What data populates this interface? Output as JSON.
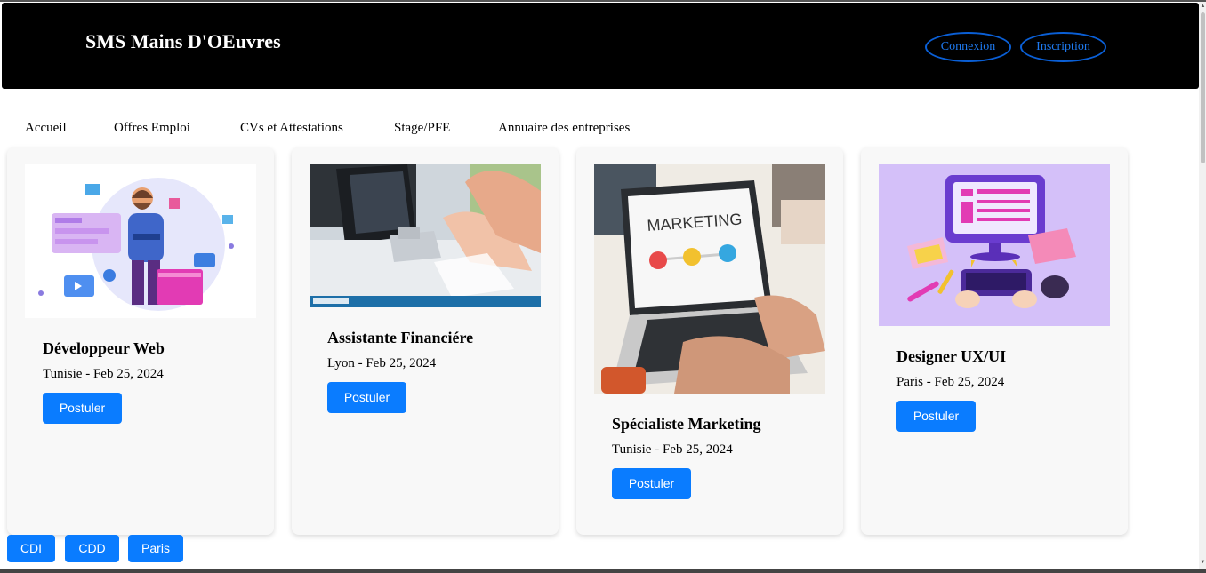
{
  "header": {
    "brand": "SMS Mains D'OEuvres",
    "login_label": "Connexion",
    "signup_label": "Inscription"
  },
  "nav": {
    "items": [
      "Accueil",
      "Offres Emploi",
      "CVs et Attestations",
      "Stage/PFE",
      "Annuaire des entreprises"
    ]
  },
  "jobs": [
    {
      "title": "Développeur Web",
      "meta": "Tunisie - Feb 25, 2024",
      "apply_label": "Postuler",
      "image": "developer-illustration"
    },
    {
      "title": "Assistante Financiére",
      "meta": "Lyon - Feb 25, 2024",
      "apply_label": "Postuler",
      "image": "finance-photo"
    },
    {
      "title": "Spécialiste Marketing",
      "meta": "Tunisie - Feb 25, 2024",
      "apply_label": "Postuler",
      "image": "marketing-photo",
      "image_text": "MARKETING"
    },
    {
      "title": "Designer UX/UI",
      "meta": "Paris - Feb 25, 2024",
      "apply_label": "Postuler",
      "image": "designer-illustration"
    }
  ],
  "filters": [
    "CDI",
    "CDD",
    "Paris"
  ],
  "colors": {
    "header_bg": "#000000",
    "accent": "#0a7cff",
    "outline": "#0a5fd6",
    "card_bg": "#f8f8f8"
  }
}
